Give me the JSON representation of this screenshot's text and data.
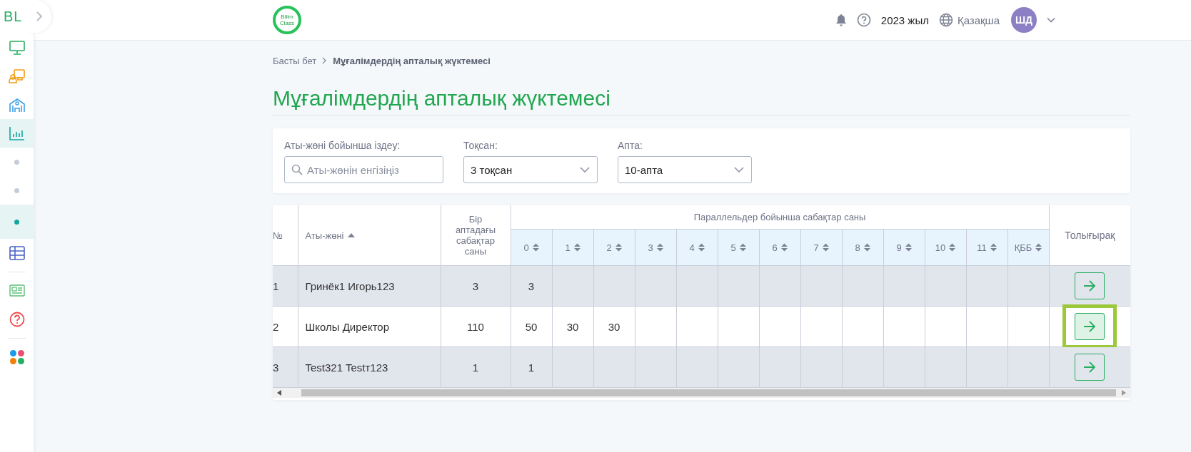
{
  "sidebar": {
    "logo": "BL",
    "items": [
      {
        "kind": "monitor",
        "selected": false
      },
      {
        "kind": "presentation",
        "selected": false
      },
      {
        "kind": "school",
        "selected": false
      },
      {
        "kind": "chart",
        "selected": true,
        "children": [
          {
            "selected": false
          },
          {
            "selected": false
          },
          {
            "selected": true
          }
        ]
      },
      {
        "kind": "table",
        "selected": false
      },
      {
        "kind": "divider"
      },
      {
        "kind": "news",
        "selected": false
      },
      {
        "kind": "help",
        "selected": false
      },
      {
        "kind": "divider"
      },
      {
        "kind": "apps",
        "selected": false
      }
    ]
  },
  "header": {
    "brand": [
      "Bilim",
      "Class"
    ],
    "year": "2023 жыл",
    "language": "Қазақша",
    "avatar": "ШД"
  },
  "breadcrumb": [
    {
      "label": "Басты бет",
      "current": false
    },
    {
      "label": "Мұғалімдердің апталық жүктемесі",
      "current": true
    }
  ],
  "title": "Мұғалімдердің апталық жүктемесі",
  "filters": {
    "search": {
      "label": "Аты-жөні бойынша іздеу:",
      "placeholder": "Аты-жөнін енгізіңіз"
    },
    "quarter": {
      "label": "Тоқсан:",
      "value": "3 тоқсан"
    },
    "week": {
      "label": "Апта:",
      "value": "10-апта"
    }
  },
  "table": {
    "columns": {
      "number": "№",
      "name": {
        "label": "Аты-жөні",
        "sorted": true
      },
      "weekly": "Бір аптадағы сабақтар саны",
      "group": "Параллельдер бойынша сабақтар саны",
      "parallels": [
        {
          "label": "0",
          "sorted": false
        },
        {
          "label": "1",
          "sorted": false
        },
        {
          "label": "2",
          "sorted": false
        },
        {
          "label": "3",
          "sorted": false
        },
        {
          "label": "4",
          "sorted": false
        },
        {
          "label": "5",
          "sorted": false
        },
        {
          "label": "6",
          "sorted": false
        },
        {
          "label": "7",
          "sorted": false
        },
        {
          "label": "8",
          "sorted": false
        },
        {
          "label": "9",
          "sorted": false
        },
        {
          "label": "10",
          "sorted": false
        },
        {
          "label": "11",
          "sorted": false
        },
        {
          "label": "ҚББ",
          "sorted": false
        }
      ],
      "details": "Толығырақ"
    },
    "rows": [
      {
        "number": "1",
        "name": "Гринёк1 Игорь123",
        "weekly": "3",
        "parallels": [
          "3"
        ],
        "highlighted": false
      },
      {
        "number": "2",
        "name": "Школы Директор",
        "weekly": "110",
        "parallels": [
          "50",
          "30",
          "30"
        ],
        "highlighted": true
      },
      {
        "number": "3",
        "name": "Test321 Testт123",
        "weekly": "1",
        "parallels": [
          "1"
        ],
        "highlighted": false
      }
    ]
  }
}
